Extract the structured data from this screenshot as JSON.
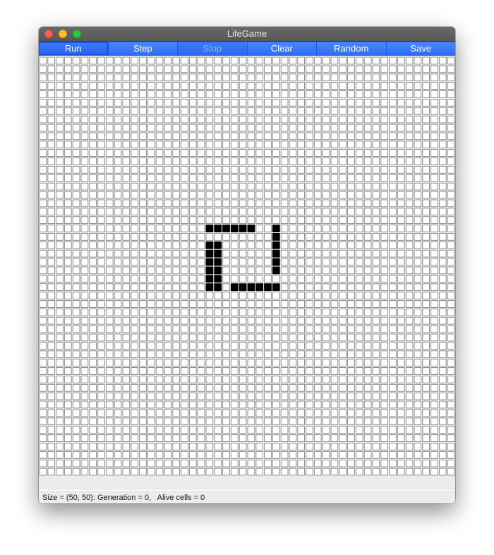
{
  "window": {
    "title": "LifeGame"
  },
  "toolbar": {
    "buttons": [
      {
        "label": "Run",
        "state": "pressed"
      },
      {
        "label": "Step",
        "state": "enabled"
      },
      {
        "label": "Stop",
        "state": "disabled"
      },
      {
        "label": "Clear",
        "state": "enabled"
      },
      {
        "label": "Random",
        "state": "enabled"
      },
      {
        "label": "Save",
        "state": "enabled"
      }
    ]
  },
  "board": {
    "columns": 50,
    "rows": 50,
    "alive_color": "#000000",
    "dead_color": "#ffffff",
    "grid_line_color": "#8a8a8a",
    "alive_cells": [
      [
        20,
        20
      ],
      [
        21,
        20
      ],
      [
        22,
        20
      ],
      [
        23,
        20
      ],
      [
        24,
        20
      ],
      [
        25,
        20
      ],
      [
        28,
        20
      ],
      [
        28,
        21
      ],
      [
        20,
        22
      ],
      [
        21,
        22
      ],
      [
        28,
        22
      ],
      [
        20,
        23
      ],
      [
        21,
        23
      ],
      [
        28,
        23
      ],
      [
        20,
        24
      ],
      [
        21,
        24
      ],
      [
        28,
        24
      ],
      [
        20,
        25
      ],
      [
        21,
        25
      ],
      [
        28,
        25
      ],
      [
        20,
        26
      ],
      [
        21,
        26
      ],
      [
        20,
        27
      ],
      [
        21,
        27
      ],
      [
        23,
        27
      ],
      [
        24,
        27
      ],
      [
        25,
        27
      ],
      [
        26,
        27
      ],
      [
        27,
        27
      ],
      [
        28,
        27
      ]
    ]
  },
  "status": {
    "text": "Size = (50, 50): Generation = 0,   Alive cells = 0"
  },
  "colors": {
    "toolbar_accent": "#2f6df6",
    "titlebar": "#5f5f5f"
  }
}
